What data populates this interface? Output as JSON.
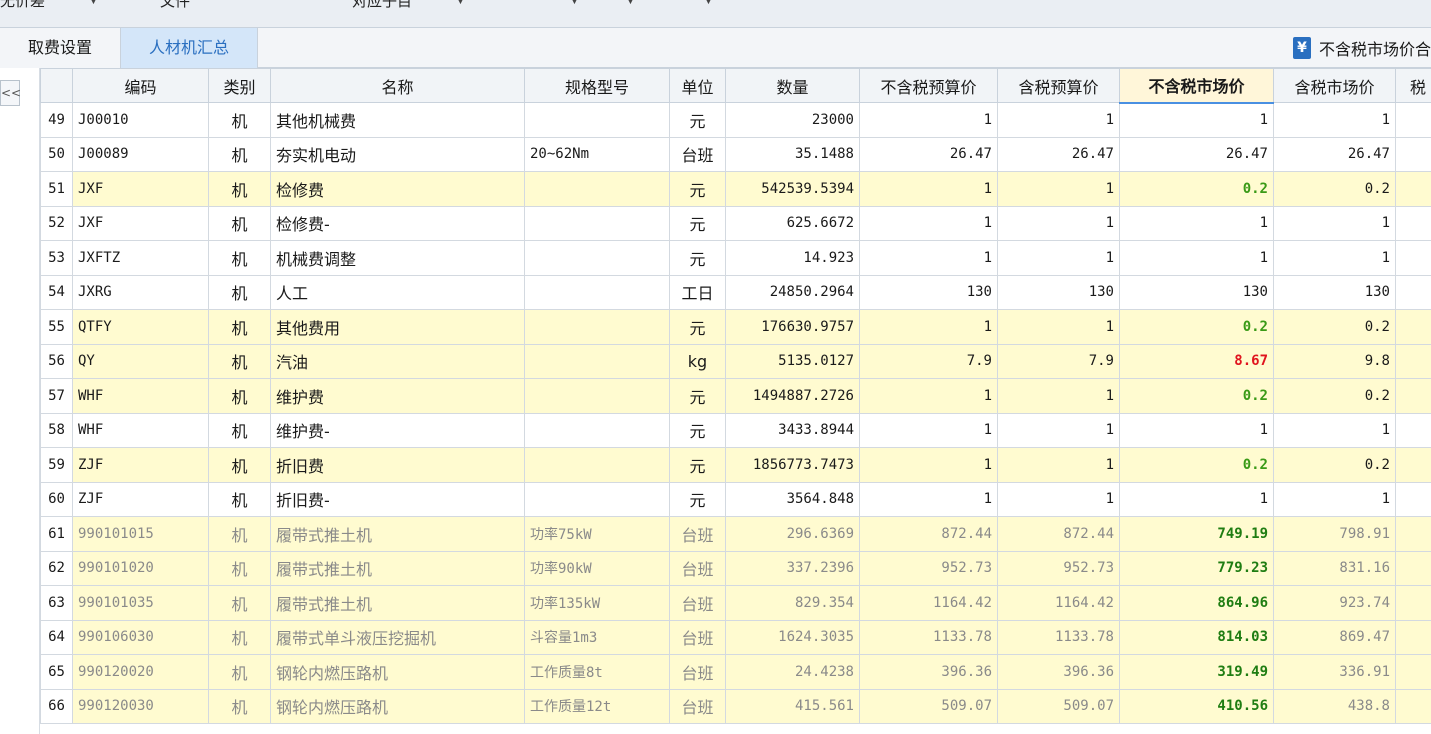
{
  "toolbar": {
    "items": [
      {
        "label": "无价差"
      },
      {
        "label": "文件"
      },
      {
        "label": "对应子目"
      }
    ]
  },
  "tabs": [
    {
      "label": "取费设置",
      "active": false
    },
    {
      "label": "人材机汇总",
      "active": true
    }
  ],
  "filter": {
    "icon": "yen-icon",
    "label": "不含税市场价合"
  },
  "collapse_label": "<<",
  "columns": [
    "编码",
    "类别",
    "名称",
    "规格型号",
    "单位",
    "数量",
    "不含税预算价",
    "含税预算价",
    "不含税市场价",
    "含税市场价",
    "税"
  ],
  "colors": {
    "highlight_row": "#fffbd0",
    "active_tab": "#d4e6f9",
    "green": "#3a9a17",
    "red": "#e0141e"
  },
  "rows": [
    {
      "no": "49",
      "code": "J00010",
      "type": "机",
      "name": "其他机械费",
      "spec": "",
      "unit": "元",
      "qty": "23000",
      "pre_ex": "1",
      "pre_inc": "1",
      "mkt_ex": "1",
      "mkt_inc": "1",
      "style": "plain",
      "mark": ""
    },
    {
      "no": "50",
      "code": "J00089",
      "type": "机",
      "name": "夯实机电动",
      "spec": "20~62Nm",
      "unit": "台班",
      "qty": "35.1488",
      "pre_ex": "26.47",
      "pre_inc": "26.47",
      "mkt_ex": "26.47",
      "mkt_inc": "26.47",
      "style": "plain",
      "mark": ""
    },
    {
      "no": "51",
      "code": "JXF",
      "type": "机",
      "name": "检修费",
      "spec": "",
      "unit": "元",
      "qty": "542539.5394",
      "pre_ex": "1",
      "pre_inc": "1",
      "mkt_ex": "0.2",
      "mkt_inc": "0.2",
      "style": "hl",
      "mark": "green"
    },
    {
      "no": "52",
      "code": "JXF",
      "type": "机",
      "name": "检修费-",
      "spec": "",
      "unit": "元",
      "qty": "625.6672",
      "pre_ex": "1",
      "pre_inc": "1",
      "mkt_ex": "1",
      "mkt_inc": "1",
      "style": "plain",
      "mark": ""
    },
    {
      "no": "53",
      "code": "JXFTZ",
      "type": "机",
      "name": "机械费调整",
      "spec": "",
      "unit": "元",
      "qty": "14.923",
      "pre_ex": "1",
      "pre_inc": "1",
      "mkt_ex": "1",
      "mkt_inc": "1",
      "style": "plain",
      "mark": ""
    },
    {
      "no": "54",
      "code": "JXRG",
      "type": "机",
      "name": "人工",
      "spec": "",
      "unit": "工日",
      "qty": "24850.2964",
      "pre_ex": "130",
      "pre_inc": "130",
      "mkt_ex": "130",
      "mkt_inc": "130",
      "style": "plain",
      "mark": ""
    },
    {
      "no": "55",
      "code": "QTFY",
      "type": "机",
      "name": "其他费用",
      "spec": "",
      "unit": "元",
      "qty": "176630.9757",
      "pre_ex": "1",
      "pre_inc": "1",
      "mkt_ex": "0.2",
      "mkt_inc": "0.2",
      "style": "hl",
      "mark": "green"
    },
    {
      "no": "56",
      "code": "QY",
      "type": "机",
      "name": "汽油",
      "spec": "",
      "unit": "kg",
      "qty": "5135.0127",
      "pre_ex": "7.9",
      "pre_inc": "7.9",
      "mkt_ex": "8.67",
      "mkt_inc": "9.8",
      "style": "hl",
      "mark": "red"
    },
    {
      "no": "57",
      "code": "WHF",
      "type": "机",
      "name": "维护费",
      "spec": "",
      "unit": "元",
      "qty": "1494887.2726",
      "pre_ex": "1",
      "pre_inc": "1",
      "mkt_ex": "0.2",
      "mkt_inc": "0.2",
      "style": "hl",
      "mark": "green"
    },
    {
      "no": "58",
      "code": "WHF",
      "type": "机",
      "name": "维护费-",
      "spec": "",
      "unit": "元",
      "qty": "3433.8944",
      "pre_ex": "1",
      "pre_inc": "1",
      "mkt_ex": "1",
      "mkt_inc": "1",
      "style": "plain",
      "mark": ""
    },
    {
      "no": "59",
      "code": "ZJF",
      "type": "机",
      "name": "折旧费",
      "spec": "",
      "unit": "元",
      "qty": "1856773.7473",
      "pre_ex": "1",
      "pre_inc": "1",
      "mkt_ex": "0.2",
      "mkt_inc": "0.2",
      "style": "hl",
      "mark": "green"
    },
    {
      "no": "60",
      "code": "ZJF",
      "type": "机",
      "name": "折旧费-",
      "spec": "",
      "unit": "元",
      "qty": "3564.848",
      "pre_ex": "1",
      "pre_inc": "1",
      "mkt_ex": "1",
      "mkt_inc": "1",
      "style": "plain",
      "mark": ""
    },
    {
      "no": "61",
      "code": "990101015",
      "type": "机",
      "name": "履带式推土机",
      "spec": "功率75kW",
      "unit": "台班",
      "qty": "296.6369",
      "pre_ex": "872.44",
      "pre_inc": "872.44",
      "mkt_ex": "749.19",
      "mkt_inc": "798.91",
      "style": "hl gray",
      "mark": "dgreen"
    },
    {
      "no": "62",
      "code": "990101020",
      "type": "机",
      "name": "履带式推土机",
      "spec": "功率90kW",
      "unit": "台班",
      "qty": "337.2396",
      "pre_ex": "952.73",
      "pre_inc": "952.73",
      "mkt_ex": "779.23",
      "mkt_inc": "831.16",
      "style": "hl gray",
      "mark": "dgreen"
    },
    {
      "no": "63",
      "code": "990101035",
      "type": "机",
      "name": "履带式推土机",
      "spec": "功率135kW",
      "unit": "台班",
      "qty": "829.354",
      "pre_ex": "1164.42",
      "pre_inc": "1164.42",
      "mkt_ex": "864.96",
      "mkt_inc": "923.74",
      "style": "hl gray",
      "mark": "dgreen"
    },
    {
      "no": "64",
      "code": "990106030",
      "type": "机",
      "name": "履带式单斗液压挖掘机",
      "spec": "斗容量1m3",
      "unit": "台班",
      "qty": "1624.3035",
      "pre_ex": "1133.78",
      "pre_inc": "1133.78",
      "mkt_ex": "814.03",
      "mkt_inc": "869.47",
      "style": "hl gray",
      "mark": "dgreen"
    },
    {
      "no": "65",
      "code": "990120020",
      "type": "机",
      "name": "钢轮内燃压路机",
      "spec": "工作质量8t",
      "unit": "台班",
      "qty": "24.4238",
      "pre_ex": "396.36",
      "pre_inc": "396.36",
      "mkt_ex": "319.49",
      "mkt_inc": "336.91",
      "style": "hl gray",
      "mark": "dgreen"
    },
    {
      "no": "66",
      "code": "990120030",
      "type": "机",
      "name": "钢轮内燃压路机",
      "spec": "工作质量12t",
      "unit": "台班",
      "qty": "415.561",
      "pre_ex": "509.07",
      "pre_inc": "509.07",
      "mkt_ex": "410.56",
      "mkt_inc": "438.8",
      "style": "hl gray",
      "mark": "dgreen"
    }
  ]
}
